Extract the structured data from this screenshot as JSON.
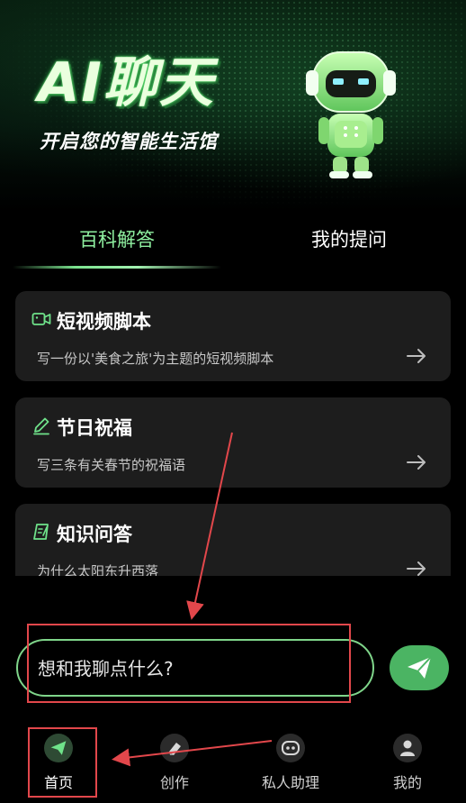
{
  "banner": {
    "title": "AI聊天",
    "subtitle": "开启您的智能生活馆"
  },
  "tabs": [
    {
      "label": "百科解答",
      "active": true
    },
    {
      "label": "我的提问",
      "active": false
    }
  ],
  "cards": [
    {
      "icon": "video-icon",
      "title": "短视频脚本",
      "desc": "写一份以'美食之旅'为主题的短视频脚本"
    },
    {
      "icon": "pencil-icon",
      "title": "节日祝福",
      "desc": "写三条有关春节的祝福语"
    },
    {
      "icon": "book-pen-icon",
      "title": "知识问答",
      "desc": "为什么太阳东升西落"
    }
  ],
  "chat_input": {
    "placeholder": "想和我聊点什么?",
    "value": ""
  },
  "send_button": {
    "icon": "send-icon"
  },
  "nav": [
    {
      "label": "首页",
      "icon": "send-icon",
      "active": true
    },
    {
      "label": "创作",
      "icon": "eraser-icon",
      "active": false
    },
    {
      "label": "私人助理",
      "icon": "robot-icon",
      "active": false
    },
    {
      "label": "我的",
      "icon": "person-icon",
      "active": false
    }
  ],
  "colors": {
    "accent": "#4bb463",
    "tab_active": "#8ff0a0",
    "card_bg": "#1d1d1d",
    "annotation": "#e2474b"
  }
}
